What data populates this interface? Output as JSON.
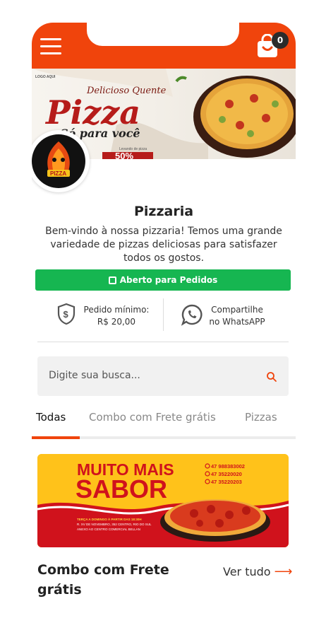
{
  "header": {
    "cart_count": "0",
    "colors": {
      "brand": "#f0440c",
      "open": "#16b651"
    }
  },
  "banner": {
    "logo_placeholder": "LOGO AQUI",
    "headline_script": "Delicioso Quente",
    "headline_main": "Pizza",
    "tagline": "Só para você",
    "promo_small": "Levando de pizza",
    "promo_value": "50%"
  },
  "store": {
    "logo_text": "PIZZA",
    "name": "Pizzaria",
    "description": "Bem-vindo à nossa pizzaria! Temos uma grande variedade de pizzas deliciosas para satisfazer todos os gostos.",
    "status_label": "Aberto para Pedidos"
  },
  "info": {
    "min_order_label": "Pedido mínimo:",
    "min_order_value": "R$ 20,00",
    "share_label": "Compartilhe",
    "share_sub": "no WhatsAPP"
  },
  "search": {
    "placeholder": "Digite sua busca..."
  },
  "tabs": [
    {
      "label": "Todas",
      "active": true
    },
    {
      "label": "Combo com Frete grátis",
      "active": false
    },
    {
      "label": "Pizzas",
      "active": false
    }
  ],
  "promo": {
    "line1": "MUITO MAIS",
    "line2": "SABOR",
    "phones": [
      "47 988383002",
      "47 35220020",
      "47 35220203"
    ],
    "hours": "TERÇA A DOMINGO À PARTIR DAS 18:30H",
    "address1": "R. XV DE NOVEMBRO, 352 CENTRO, RIO DO SUL",
    "address2": "ANEXO AO CENTRO COMERCIAL BELLAN"
  },
  "section": {
    "title": "Combo com Frete grátis",
    "see_all": "Ver tudo"
  }
}
